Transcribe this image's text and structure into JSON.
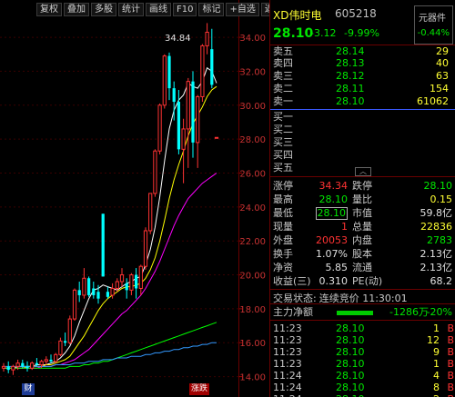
{
  "toolbar": {
    "buttons": [
      "复权",
      "叠加",
      "多股",
      "统计",
      "画线",
      "F10",
      "标记",
      "+自选",
      "返回"
    ]
  },
  "chart": {
    "high_label": "34.84",
    "axis_ticks": [
      "34.00",
      "32.00",
      "30.00",
      "28.00",
      "26.00",
      "24.00",
      "22.00",
      "20.00",
      "18.00",
      "16.00",
      "14.00"
    ],
    "ex_rights_tag": "财",
    "limit_tag": "涨跌",
    "colors": {
      "up": "#ff3333",
      "down": "#00ffff",
      "ma5": "#ffffff",
      "ma10": "#ffff00",
      "ma20": "#ff00ff",
      "ma60": "#00ff00",
      "ma120": "#3399ff"
    }
  },
  "chart_data": {
    "type": "candlestick",
    "title": "",
    "ylim": [
      12.8,
      36.2
    ],
    "ticks": [
      34,
      32,
      30,
      28,
      26,
      24,
      22,
      20,
      18,
      16,
      14
    ],
    "candles": [
      {
        "o": 14.5,
        "h": 14.8,
        "l": 14.3,
        "c": 14.6
      },
      {
        "o": 14.6,
        "h": 14.9,
        "l": 14.2,
        "c": 14.4
      },
      {
        "o": 14.4,
        "h": 14.7,
        "l": 14.1,
        "c": 14.6
      },
      {
        "o": 14.6,
        "h": 15.0,
        "l": 14.4,
        "c": 14.8
      },
      {
        "o": 14.8,
        "h": 15.0,
        "l": 14.5,
        "c": 14.6
      },
      {
        "o": 14.6,
        "h": 14.9,
        "l": 14.3,
        "c": 14.5
      },
      {
        "o": 14.5,
        "h": 14.9,
        "l": 14.4,
        "c": 14.8
      },
      {
        "o": 14.8,
        "h": 15.1,
        "l": 14.6,
        "c": 14.7
      },
      {
        "o": 14.7,
        "h": 15.0,
        "l": 14.5,
        "c": 14.9
      },
      {
        "o": 14.9,
        "h": 15.2,
        "l": 14.7,
        "c": 15.0
      },
      {
        "o": 15.0,
        "h": 15.3,
        "l": 14.8,
        "c": 14.9
      },
      {
        "o": 14.9,
        "h": 15.4,
        "l": 14.8,
        "c": 15.3
      },
      {
        "o": 15.3,
        "h": 16.3,
        "l": 15.2,
        "c": 16.1
      },
      {
        "o": 16.1,
        "h": 16.6,
        "l": 15.8,
        "c": 16.0
      },
      {
        "o": 16.0,
        "h": 17.6,
        "l": 15.9,
        "c": 17.4
      },
      {
        "o": 17.4,
        "h": 19.2,
        "l": 17.3,
        "c": 19.1
      },
      {
        "o": 19.1,
        "h": 19.6,
        "l": 18.4,
        "c": 18.8
      },
      {
        "o": 18.8,
        "h": 20.4,
        "l": 18.6,
        "c": 19.8
      },
      {
        "o": 19.8,
        "h": 19.9,
        "l": 18.7,
        "c": 18.8
      },
      {
        "o": 19.2,
        "h": 19.6,
        "l": 18.6,
        "c": 18.8
      },
      {
        "o": 19.0,
        "h": 19.4,
        "l": 18.3,
        "c": 18.6
      },
      {
        "o": 23.6,
        "h": 23.6,
        "l": 19.9,
        "c": 19.9
      },
      {
        "o": 19.0,
        "h": 19.3,
        "l": 18.6,
        "c": 18.7
      },
      {
        "o": 18.8,
        "h": 19.5,
        "l": 18.6,
        "c": 19.2
      },
      {
        "o": 19.2,
        "h": 19.8,
        "l": 19.0,
        "c": 19.6
      },
      {
        "o": 19.6,
        "h": 20.4,
        "l": 19.3,
        "c": 20.0
      },
      {
        "o": 19.5,
        "h": 19.8,
        "l": 18.6,
        "c": 19.1
      },
      {
        "o": 19.1,
        "h": 20.1,
        "l": 18.8,
        "c": 20.0
      },
      {
        "o": 20.0,
        "h": 20.4,
        "l": 18.6,
        "c": 19.2
      },
      {
        "o": 19.2,
        "h": 20.6,
        "l": 18.8,
        "c": 20.5
      },
      {
        "o": 20.5,
        "h": 22.8,
        "l": 20.3,
        "c": 22.6
      },
      {
        "o": 22.6,
        "h": 24.8,
        "l": 22.4,
        "c": 24.8
      },
      {
        "o": 24.8,
        "h": 27.4,
        "l": 24.6,
        "c": 27.3
      },
      {
        "o": 27.3,
        "h": 30.1,
        "l": 27.1,
        "c": 30.0
      },
      {
        "o": 30.0,
        "h": 33.0,
        "l": 29.8,
        "c": 32.9
      },
      {
        "o": 32.9,
        "h": 33.1,
        "l": 30.3,
        "c": 31.0
      },
      {
        "o": 31.0,
        "h": 31.4,
        "l": 29.1,
        "c": 30.2
      },
      {
        "o": 30.2,
        "h": 30.9,
        "l": 27.1,
        "c": 27.4
      },
      {
        "o": 27.4,
        "h": 29.2,
        "l": 25.4,
        "c": 28.6
      },
      {
        "o": 28.6,
        "h": 31.6,
        "l": 26.3,
        "c": 31.4
      },
      {
        "o": 31.4,
        "h": 32.0,
        "l": 26.9,
        "c": 27.8
      },
      {
        "o": 27.8,
        "h": 30.6,
        "l": 26.3,
        "c": 30.5
      },
      {
        "o": 30.5,
        "h": 33.6,
        "l": 30.2,
        "c": 33.5
      },
      {
        "o": 33.5,
        "h": 34.84,
        "l": 33.0,
        "c": 34.3
      },
      {
        "o": 33.3,
        "h": 34.5,
        "l": 31.0,
        "c": 31.2
      },
      {
        "o": 28.1,
        "h": 28.1,
        "l": 28.1,
        "c": 28.1
      }
    ],
    "series": [
      {
        "name": "MA5",
        "values": [
          14.5,
          14.5,
          14.5,
          14.6,
          14.6,
          14.6,
          14.6,
          14.7,
          14.7,
          14.7,
          14.8,
          14.9,
          15.1,
          15.4,
          15.8,
          16.4,
          17.2,
          17.9,
          18.6,
          19.1,
          19.2,
          19.4,
          19.3,
          19.2,
          19.1,
          19.3,
          19.5,
          19.6,
          19.8,
          19.9,
          20.6,
          21.5,
          22.8,
          24.6,
          26.7,
          28.6,
          29.7,
          30.3,
          30.6,
          31.3,
          31.1,
          31.0,
          31.4,
          32.2,
          32.0,
          31.3
        ]
      },
      {
        "name": "MA10",
        "values": [
          14.5,
          14.5,
          14.5,
          14.5,
          14.5,
          14.6,
          14.6,
          14.6,
          14.6,
          14.7,
          14.7,
          14.8,
          14.9,
          15.0,
          15.2,
          15.6,
          16.0,
          16.4,
          16.9,
          17.4,
          17.9,
          18.3,
          18.6,
          18.8,
          19.0,
          19.2,
          19.3,
          19.3,
          19.4,
          19.5,
          19.8,
          20.3,
          21.0,
          22.0,
          23.2,
          24.5,
          25.6,
          26.5,
          27.3,
          28.2,
          28.9,
          29.4,
          29.9,
          30.5,
          30.9,
          31.1
        ]
      },
      {
        "name": "MA20",
        "values": [
          14.5,
          14.5,
          14.5,
          14.5,
          14.5,
          14.5,
          14.5,
          14.5,
          14.6,
          14.6,
          14.6,
          14.7,
          14.7,
          14.8,
          14.9,
          15.0,
          15.2,
          15.4,
          15.6,
          15.9,
          16.2,
          16.5,
          16.8,
          17.1,
          17.4,
          17.7,
          17.9,
          18.2,
          18.5,
          18.8,
          19.2,
          19.7,
          20.2,
          20.8,
          21.5,
          22.2,
          22.9,
          23.5,
          24.0,
          24.5,
          24.8,
          25.1,
          25.4,
          25.6,
          25.8,
          26.0
        ]
      },
      {
        "name": "MA60",
        "values": [
          14.5,
          14.5,
          14.5,
          14.5,
          14.5,
          14.5,
          14.5,
          14.5,
          14.5,
          14.5,
          14.5,
          14.5,
          14.5,
          14.5,
          14.6,
          14.6,
          14.6,
          14.7,
          14.7,
          14.8,
          14.8,
          14.9,
          14.9,
          15.0,
          15.1,
          15.2,
          15.3,
          15.4,
          15.5,
          15.6,
          15.7,
          15.8,
          15.9,
          16.0,
          16.1,
          16.2,
          16.3,
          16.4,
          16.5,
          16.6,
          16.7,
          16.8,
          16.9,
          17.0,
          17.1,
          17.2
        ]
      },
      {
        "name": "MA120",
        "values": [
          14.6,
          14.6,
          14.6,
          14.6,
          14.6,
          14.6,
          14.6,
          14.6,
          14.6,
          14.6,
          14.6,
          14.7,
          14.7,
          14.7,
          14.7,
          14.8,
          14.8,
          14.8,
          14.9,
          14.9,
          14.9,
          15.0,
          15.0,
          15.0,
          15.1,
          15.1,
          15.1,
          15.2,
          15.2,
          15.2,
          15.3,
          15.3,
          15.4,
          15.4,
          15.5,
          15.5,
          15.6,
          15.6,
          15.7,
          15.7,
          15.8,
          15.8,
          15.9,
          15.9,
          16.0,
          16.0
        ]
      }
    ]
  },
  "quote": {
    "name": "XD伟时电",
    "code": "605218",
    "price": "28.10",
    "change": "-3.12",
    "change_pct": "-9.99%",
    "parts_label": "元器件",
    "parts_pct": "-0.44%"
  },
  "orderbook": {
    "asks": [
      {
        "label": "卖五",
        "price": "28.14",
        "vol": "29"
      },
      {
        "label": "卖四",
        "price": "28.13",
        "vol": "40"
      },
      {
        "label": "卖三",
        "price": "28.12",
        "vol": "63"
      },
      {
        "label": "卖二",
        "price": "28.11",
        "vol": "154"
      },
      {
        "label": "卖一",
        "price": "28.10",
        "vol": "61062"
      }
    ],
    "bids": [
      {
        "label": "买一",
        "price": "",
        "vol": ""
      },
      {
        "label": "买二",
        "price": "",
        "vol": ""
      },
      {
        "label": "买三",
        "price": "",
        "vol": ""
      },
      {
        "label": "买四",
        "price": "",
        "vol": ""
      },
      {
        "label": "买五",
        "price": "",
        "vol": ""
      }
    ]
  },
  "stats": [
    {
      "l1": "涨停",
      "v1": "34.34",
      "c1": "red",
      "l2": "跌停",
      "v2": "28.10",
      "c2": "green"
    },
    {
      "l1": "最高",
      "v1": "28.10",
      "c1": "green",
      "l2": "量比",
      "v2": "0.15",
      "c2": "yellow"
    },
    {
      "l1": "最低",
      "v1": "28.10",
      "c1": "green",
      "l2": "市值",
      "v2": "59.8亿",
      "c2": "white"
    },
    {
      "l1": "现量",
      "v1": "1",
      "c1": "red",
      "l2": "总量",
      "v2": "22836",
      "c2": "yellow"
    },
    {
      "l1": "外盘",
      "v1": "20053",
      "c1": "red",
      "l2": "内盘",
      "v2": "2783",
      "c2": "green"
    },
    {
      "l1": "换手",
      "v1": "1.07%",
      "c1": "white",
      "l2": "股本",
      "v2": "2.13亿",
      "c2": "white"
    },
    {
      "l1": "净资",
      "v1": "5.85",
      "c1": "white",
      "l2": "流通",
      "v2": "2.13亿",
      "c2": "white"
    },
    {
      "l1": "收益(三)",
      "v1": "0.310",
      "c1": "white",
      "l2": "PE(动)",
      "v2": "68.2",
      "c2": "white"
    }
  ],
  "trade_state": {
    "label": "交易状态:",
    "value": "连续竞价 11:30:01"
  },
  "money_flow": {
    "label": "主力净额",
    "value": "-1286万",
    "pct": "-20%"
  },
  "ticks": [
    {
      "time": "11:23",
      "price": "28.10",
      "vol": "1",
      "side": "B"
    },
    {
      "time": "11:23",
      "price": "28.10",
      "vol": "12",
      "side": "B"
    },
    {
      "time": "11:23",
      "price": "28.10",
      "vol": "9",
      "side": "B"
    },
    {
      "time": "11:23",
      "price": "28.10",
      "vol": "1",
      "side": "B"
    },
    {
      "time": "11:24",
      "price": "28.10",
      "vol": "4",
      "side": "B"
    },
    {
      "time": "11:24",
      "price": "28.10",
      "vol": "8",
      "side": "B"
    },
    {
      "time": "11:24",
      "price": "28.10",
      "vol": "2",
      "side": "B"
    }
  ]
}
